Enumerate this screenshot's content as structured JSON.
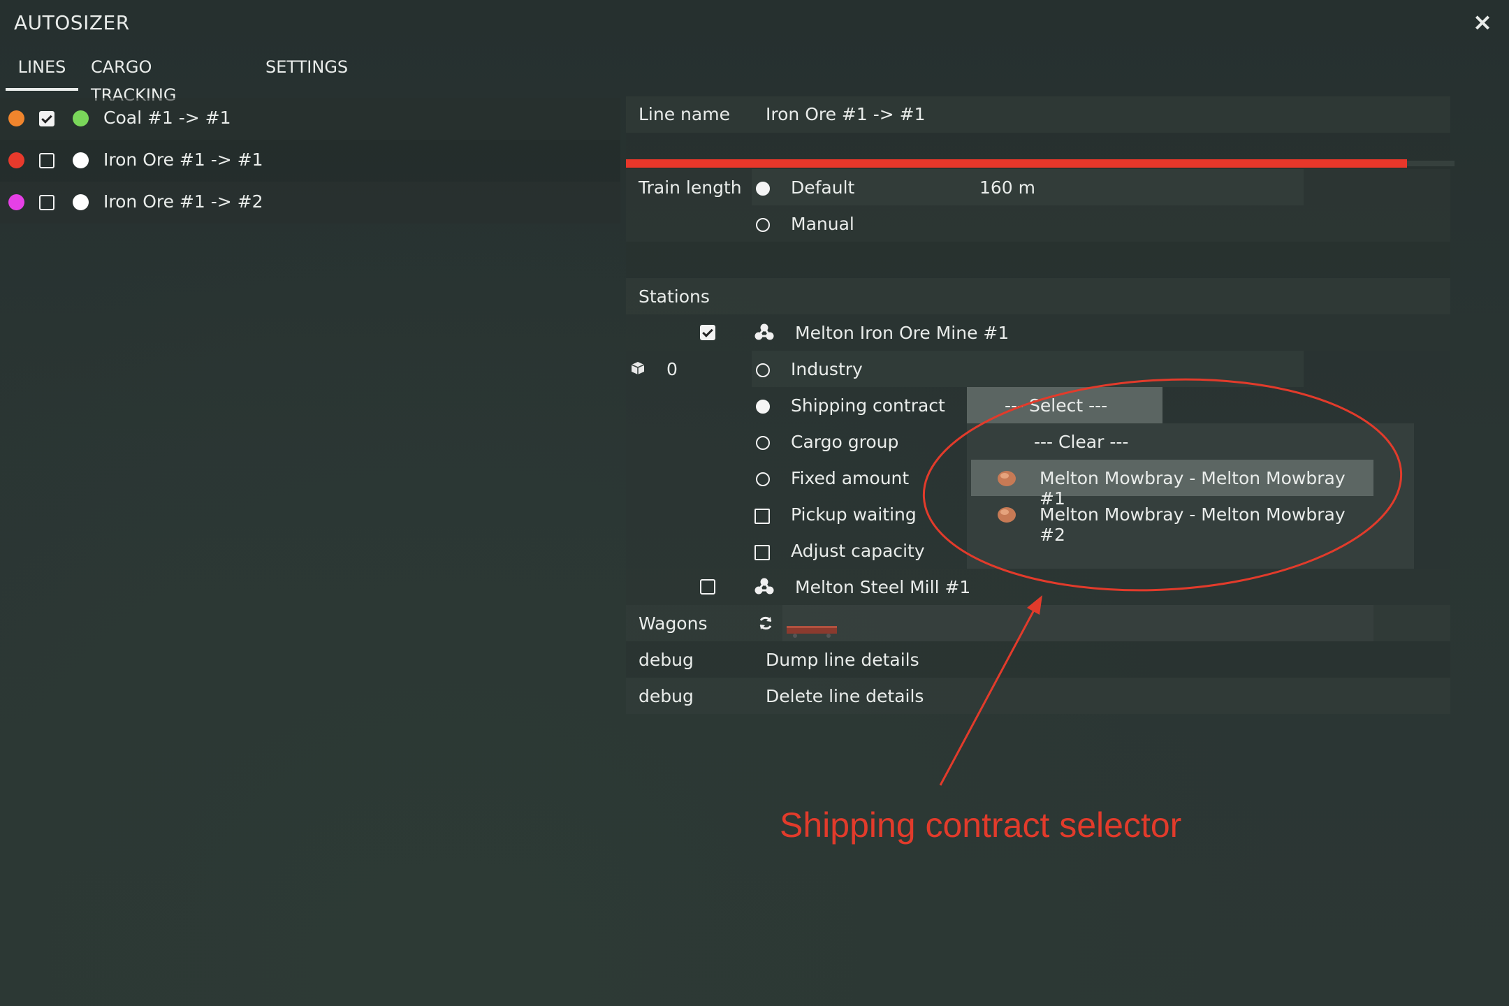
{
  "window": {
    "title": "AUTOSIZER",
    "close_label": "×"
  },
  "tabs": [
    {
      "label": "LINES",
      "active": true
    },
    {
      "label": "CARGO TRACKING",
      "active": false
    },
    {
      "label": "SETTINGS",
      "active": false
    }
  ],
  "lines": [
    {
      "color": "#f0852d",
      "checked": true,
      "status_color": "#7ad65a",
      "label": "Coal #1 -> #1"
    },
    {
      "color": "#e83a2c",
      "checked": false,
      "status_color": "#ffffff",
      "label": "Iron Ore #1 -> #1"
    },
    {
      "color": "#e640e6",
      "checked": false,
      "status_color": "#ffffff",
      "label": "Iron Ore #1 -> #2"
    }
  ],
  "details": {
    "line_name_label": "Line name",
    "line_name_value": "Iron Ore #1 -> #1",
    "line_color": "#e8372a",
    "train_length_label": "Train length",
    "train_length_options": [
      {
        "label": "Default",
        "selected": true
      },
      {
        "label": "Manual",
        "selected": false
      }
    ],
    "train_length_value": "160 m",
    "stations_label": "Stations",
    "station1": {
      "checked": true,
      "name": "Melton Iron Ore Mine #1",
      "cargo_count": "0"
    },
    "station1_options": [
      {
        "label": "Industry",
        "type": "radio",
        "selected": false
      },
      {
        "label": "Shipping contract",
        "type": "radio",
        "selected": true
      },
      {
        "label": "Cargo group",
        "type": "radio",
        "selected": false
      },
      {
        "label": "Fixed amount",
        "type": "radio",
        "selected": false
      },
      {
        "label": "Pickup waiting",
        "type": "checkbox",
        "selected": false
      },
      {
        "label": "Adjust capacity",
        "type": "checkbox",
        "selected": false
      }
    ],
    "contract_dropdown": {
      "selected": "--- Select ---",
      "options": [
        "--- Clear ---",
        "Melton Mowbray - Melton Mowbray #1",
        "Melton Mowbray - Melton Mowbray #2"
      ]
    },
    "station2": {
      "checked": false,
      "name": "Melton Steel Mill #1"
    },
    "wagons_label": "Wagons",
    "debug_rows": [
      {
        "label": "debug",
        "action": "Dump line details"
      },
      {
        "label": "debug",
        "action": "Delete line details"
      }
    ]
  },
  "annotation": {
    "text": "Shipping contract selector",
    "color": "#e23b2b"
  }
}
